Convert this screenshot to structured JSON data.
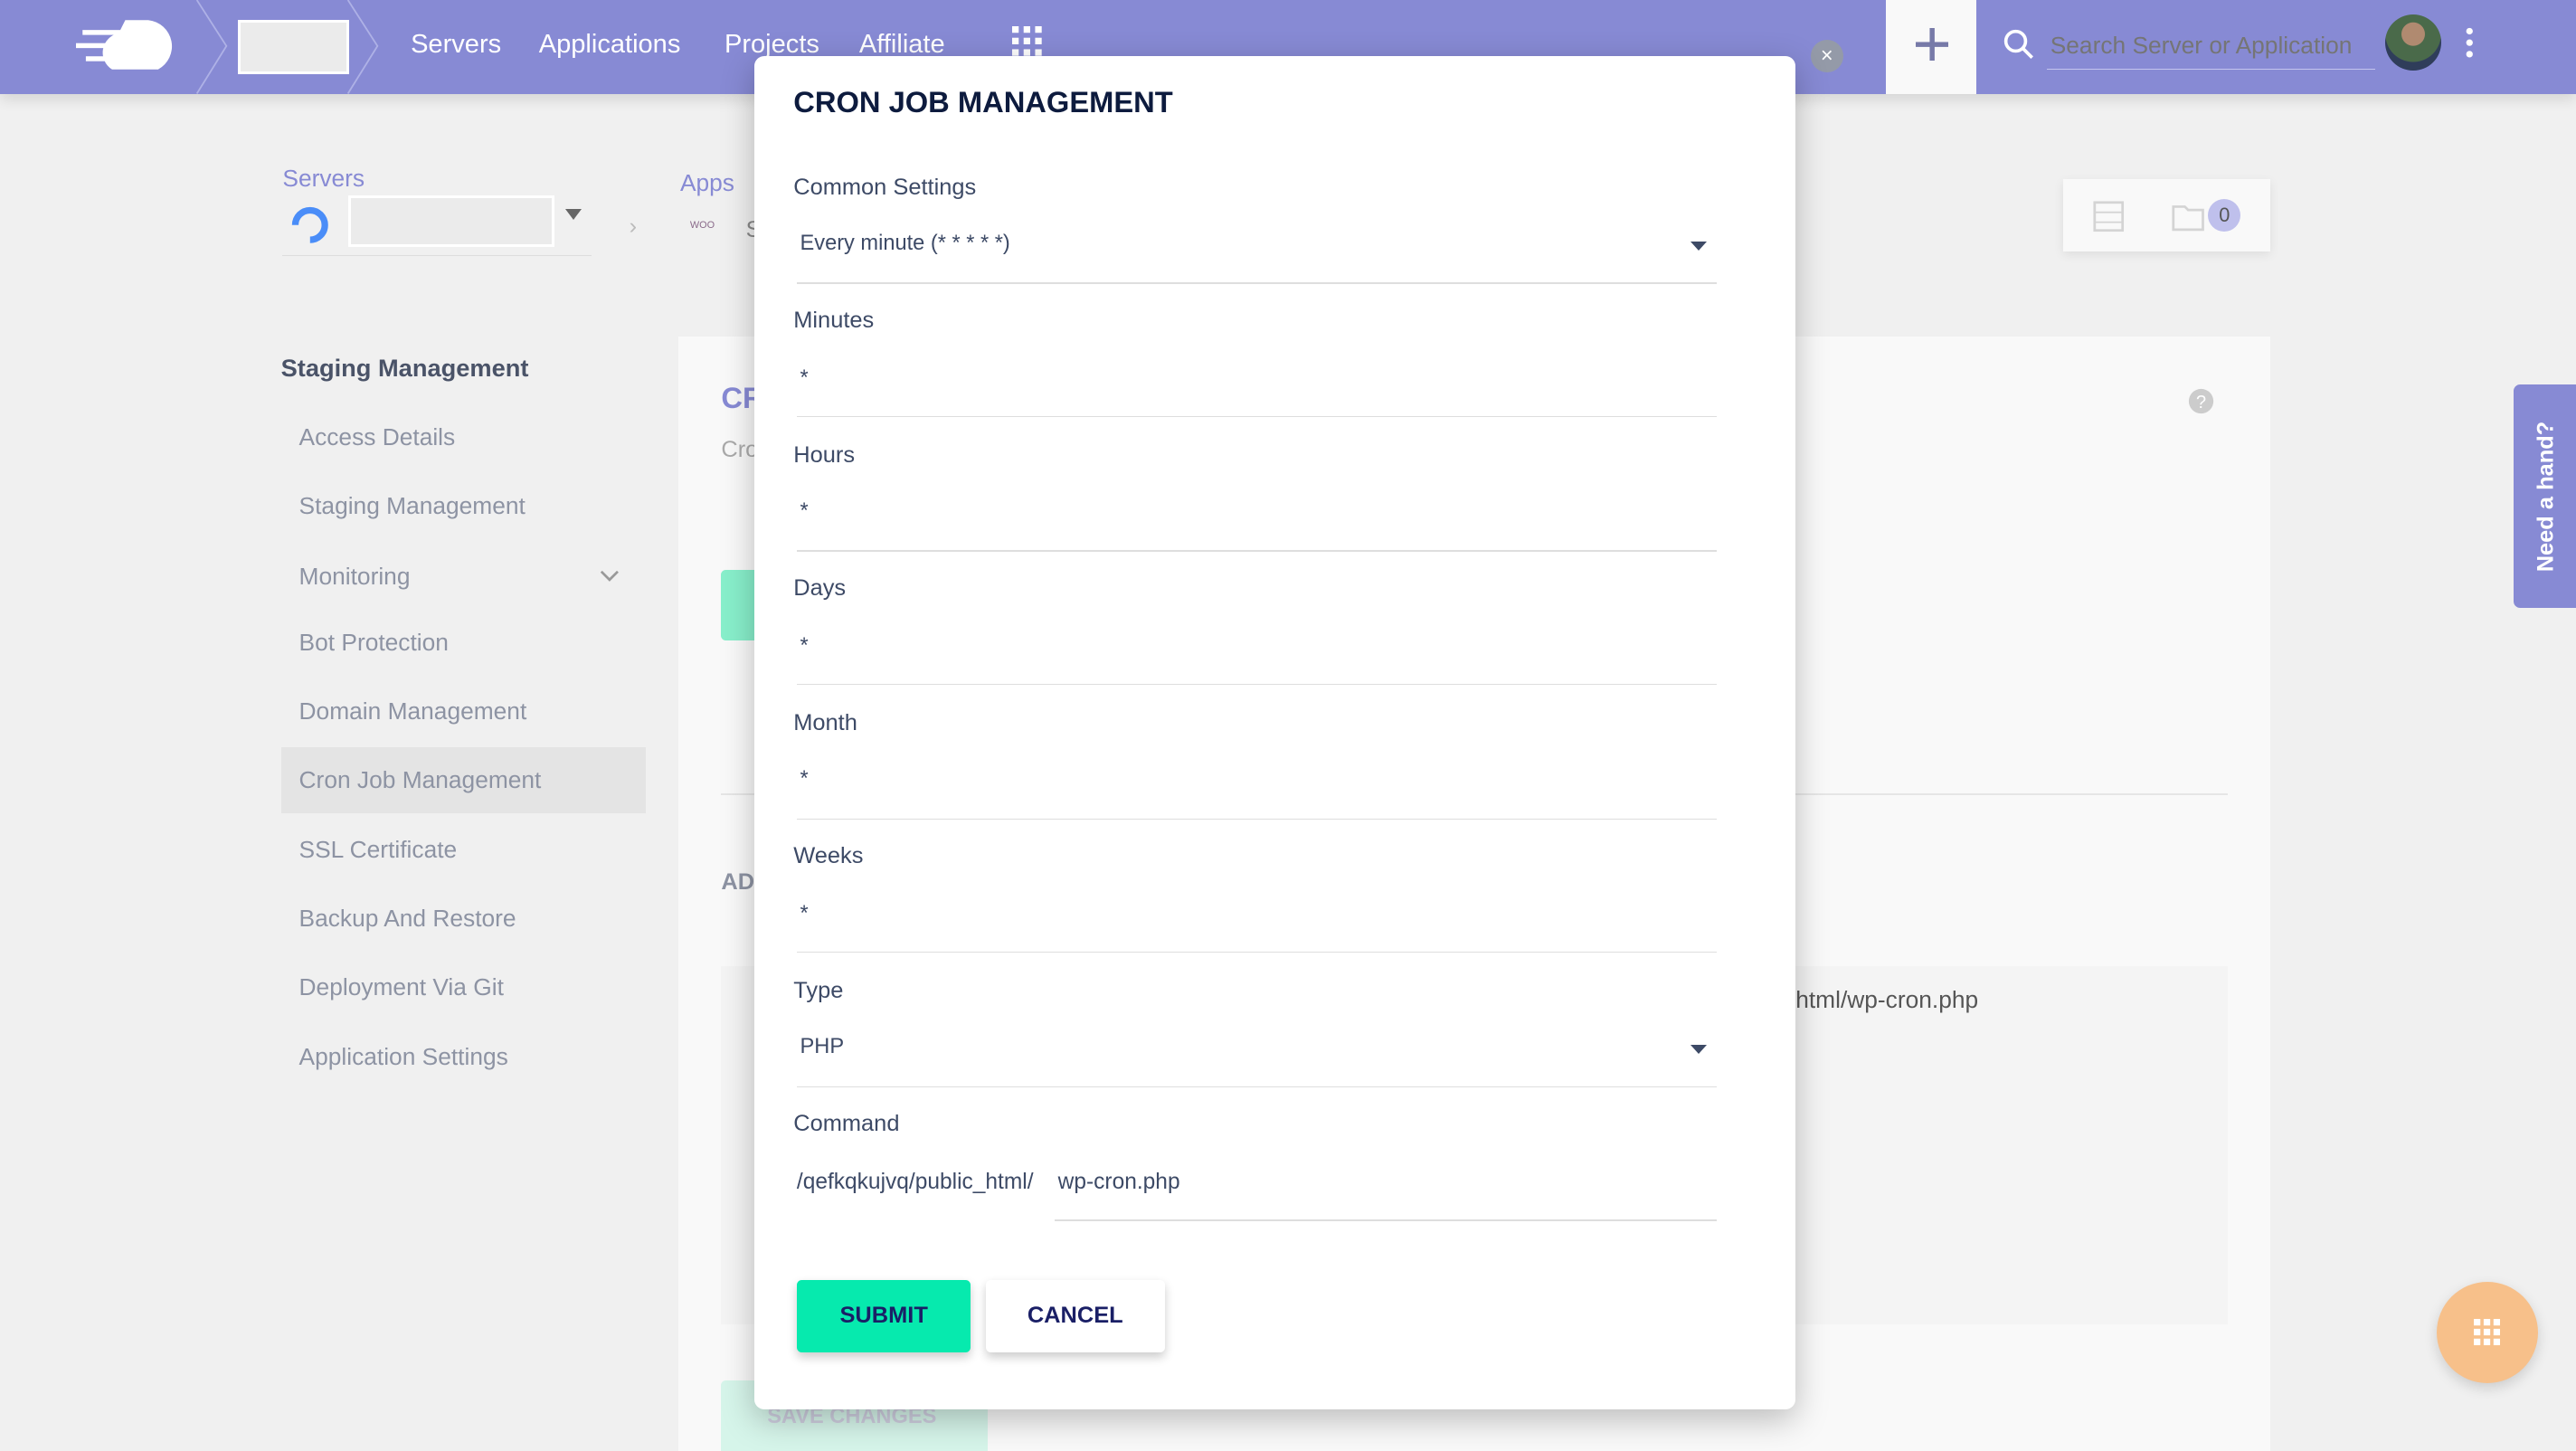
{
  "topbar": {
    "nav": [
      "Servers",
      "Applications",
      "Projects",
      "Affiliate"
    ],
    "search_placeholder": "Search Server or Application",
    "accent": "#878ad4"
  },
  "breadcrumb": {
    "servers_label": "Servers",
    "apps_label": "Apps",
    "app_initial": "S"
  },
  "toolbar": {
    "files_count": "0"
  },
  "sidebar": {
    "heading": "Staging Management",
    "items": [
      {
        "label": "Access Details"
      },
      {
        "label": "Staging Management"
      },
      {
        "label": "Monitoring"
      },
      {
        "label": "Bot Protection"
      },
      {
        "label": "Domain Management"
      },
      {
        "label": "Cron Job Management",
        "active": true
      },
      {
        "label": "SSL Certificate"
      },
      {
        "label": "Backup And Restore"
      },
      {
        "label": "Deployment Via Git"
      },
      {
        "label": "Application Settings"
      }
    ]
  },
  "background": {
    "title_partial": "CR",
    "subtitle_partial": "Cro",
    "section_partial": "AD",
    "command_partial": "html/wp-cron.php",
    "save_label": "SAVE CHANGES"
  },
  "modal": {
    "title": "CRON JOB MANAGEMENT",
    "common_settings": {
      "label": "Common Settings",
      "value": "Every minute (* * * * *)"
    },
    "minutes": {
      "label": "Minutes",
      "value": "*"
    },
    "hours": {
      "label": "Hours",
      "value": "*"
    },
    "days": {
      "label": "Days",
      "value": "*"
    },
    "month": {
      "label": "Month",
      "value": "*"
    },
    "weeks": {
      "label": "Weeks",
      "value": "*"
    },
    "type": {
      "label": "Type",
      "value": "PHP"
    },
    "command": {
      "label": "Command",
      "prefix": "/qefkqkujvq/public_html/",
      "value": "wp-cron.php"
    },
    "submit": "SUBMIT",
    "cancel": "CANCEL"
  },
  "help_tab": "Need a hand?",
  "colors": {
    "submit": "#06eaae",
    "help_tab": "#878ad4",
    "fab": "#f7c08a"
  }
}
